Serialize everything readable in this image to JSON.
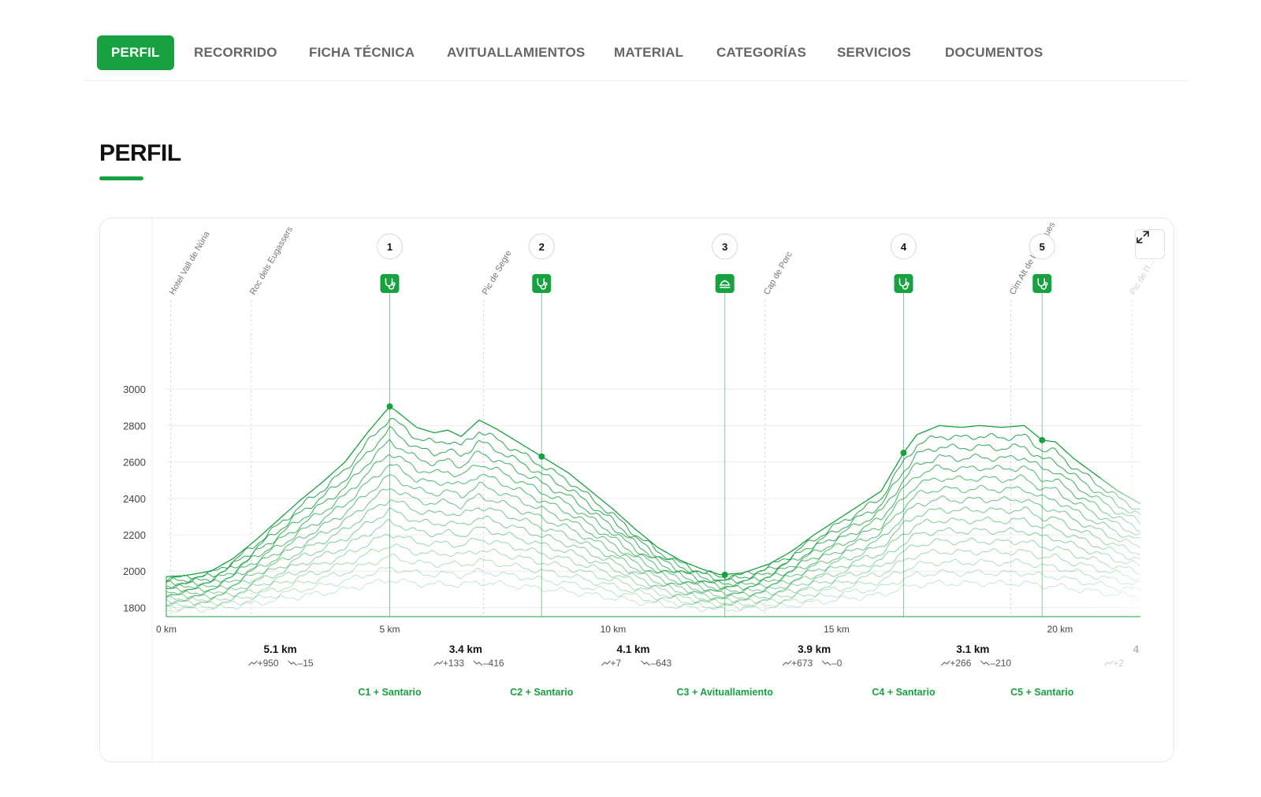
{
  "tabs": [
    {
      "label": "PERFIL",
      "active": true
    },
    {
      "label": "RECORRIDO"
    },
    {
      "label": "FICHA TÉCNICA"
    },
    {
      "label": "AVITUALLAMIENTOS"
    },
    {
      "label": "MATERIAL"
    },
    {
      "label": "CATEGORÍAS"
    },
    {
      "label": "SERVICIOS"
    },
    {
      "label": "DOCUMENTOS"
    }
  ],
  "section_title": "PERFIL",
  "colors": {
    "accent": "#18a140",
    "grid": "#ececec",
    "waypoint": "#b5b5b5"
  },
  "icons": {
    "expand": "expand-icon",
    "medical": "stethoscope-icon",
    "food": "food-station-icon"
  },
  "chart_data": {
    "type": "line",
    "xlabel": "",
    "ylabel": "",
    "xlim": [
      0,
      21.8
    ],
    "ylim": [
      1750,
      3100
    ],
    "x_ticks": [
      {
        "value": 0,
        "label": "0 km"
      },
      {
        "value": 5,
        "label": "5 km"
      },
      {
        "value": 10,
        "label": "10 km"
      },
      {
        "value": 15,
        "label": "15 km"
      },
      {
        "value": 20,
        "label": "20 km"
      }
    ],
    "y_ticks": [
      1800,
      2000,
      2200,
      2400,
      2600,
      2800,
      3000
    ],
    "grid": true,
    "profile": [
      [
        0,
        1970
      ],
      [
        0.4,
        1975
      ],
      [
        1,
        2000
      ],
      [
        1.5,
        2070
      ],
      [
        2,
        2170
      ],
      [
        2.5,
        2280
      ],
      [
        3,
        2390
      ],
      [
        3.5,
        2490
      ],
      [
        4,
        2600
      ],
      [
        4.5,
        2760
      ],
      [
        5,
        2905
      ],
      [
        5.2,
        2870
      ],
      [
        5.6,
        2790
      ],
      [
        6,
        2760
      ],
      [
        6.3,
        2775
      ],
      [
        6.6,
        2740
      ],
      [
        7,
        2830
      ],
      [
        7.4,
        2780
      ],
      [
        8,
        2690
      ],
      [
        8.4,
        2630
      ],
      [
        9,
        2540
      ],
      [
        9.5,
        2440
      ],
      [
        10,
        2340
      ],
      [
        10.5,
        2230
      ],
      [
        11,
        2130
      ],
      [
        11.5,
        2060
      ],
      [
        12,
        2010
      ],
      [
        12.4,
        1980
      ],
      [
        12.9,
        1990
      ],
      [
        13.5,
        2040
      ],
      [
        14,
        2110
      ],
      [
        14.5,
        2200
      ],
      [
        15,
        2280
      ],
      [
        15.5,
        2360
      ],
      [
        16,
        2440
      ],
      [
        16.5,
        2650
      ],
      [
        16.8,
        2750
      ],
      [
        17.3,
        2800
      ],
      [
        17.8,
        2790
      ],
      [
        18.2,
        2800
      ],
      [
        18.7,
        2790
      ],
      [
        19.2,
        2800
      ],
      [
        19.6,
        2720
      ],
      [
        19.9,
        2710
      ],
      [
        20.3,
        2620
      ],
      [
        20.8,
        2530
      ],
      [
        21.3,
        2440
      ],
      [
        21.8,
        2370
      ]
    ],
    "waypoints": [
      {
        "name": "Hotel Vall de Núria",
        "x": 0.1
      },
      {
        "name": "Roc dels Eugassers",
        "x": 1.9
      },
      {
        "name": "Pic de Segre",
        "x": 7.1
      },
      {
        "name": "Cap de Porc",
        "x": 13.4
      },
      {
        "name": "Cim Alt de les Arques",
        "x": 18.9
      },
      {
        "name": "Pic de l'I...",
        "x": 21.6
      }
    ],
    "checkpoints": [
      {
        "number": "1",
        "x": 5.0,
        "y": 2905,
        "label": "C1 + Santario",
        "icon": "stethoscope-icon"
      },
      {
        "number": "2",
        "x": 8.4,
        "y": 2630,
        "label": "C2 + Santario",
        "icon": "stethoscope-icon"
      },
      {
        "number": "3",
        "x": 12.5,
        "y": 1980,
        "label": "C3 + Avituallamiento",
        "icon": "food-station-icon"
      },
      {
        "number": "4",
        "x": 16.5,
        "y": 2650,
        "label": "C4 + Santario",
        "icon": "stethoscope-icon"
      },
      {
        "number": "5",
        "x": 19.6,
        "y": 2720,
        "label": "C5 + Santario",
        "icon": "stethoscope-icon"
      }
    ],
    "segments": [
      {
        "x": 2.55,
        "distance": "5.1 km",
        "up": "+950",
        "down": "–15"
      },
      {
        "x": 6.7,
        "distance": "3.4 km",
        "up": "+133",
        "down": "–416"
      },
      {
        "x": 10.45,
        "distance": "4.1 km",
        "up": "+7",
        "down": "–643"
      },
      {
        "x": 14.5,
        "distance": "3.9 km",
        "up": "+673",
        "down": "–0"
      },
      {
        "x": 18.05,
        "distance": "3.1 km",
        "up": "+266",
        "down": "–210"
      },
      {
        "x": 21.7,
        "distance": "4",
        "up": "+2",
        "down": ""
      }
    ]
  }
}
